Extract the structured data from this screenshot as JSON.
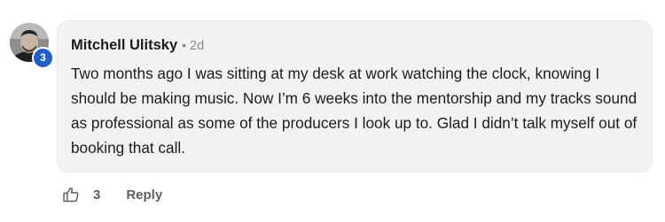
{
  "comment": {
    "author": "Mitchell Ulitsky",
    "separator": "•",
    "time": "2d",
    "level_badge": "3",
    "text": "Two months ago I was sitting at my desk at work watching the clock, knowing I should be making music. Now I’m 6 weeks into the mentorship and my tracks sound as professional as some of the producers I look up to. Glad I didn’t talk myself out of booking that call.",
    "avatar_icon": "user-avatar-photo",
    "badge_color": "#1f5fc9",
    "bubble_color": "#f2f2f2"
  },
  "actions": {
    "like_icon": "thumbs-up-icon",
    "like_count": "3",
    "reply_label": "Reply"
  }
}
